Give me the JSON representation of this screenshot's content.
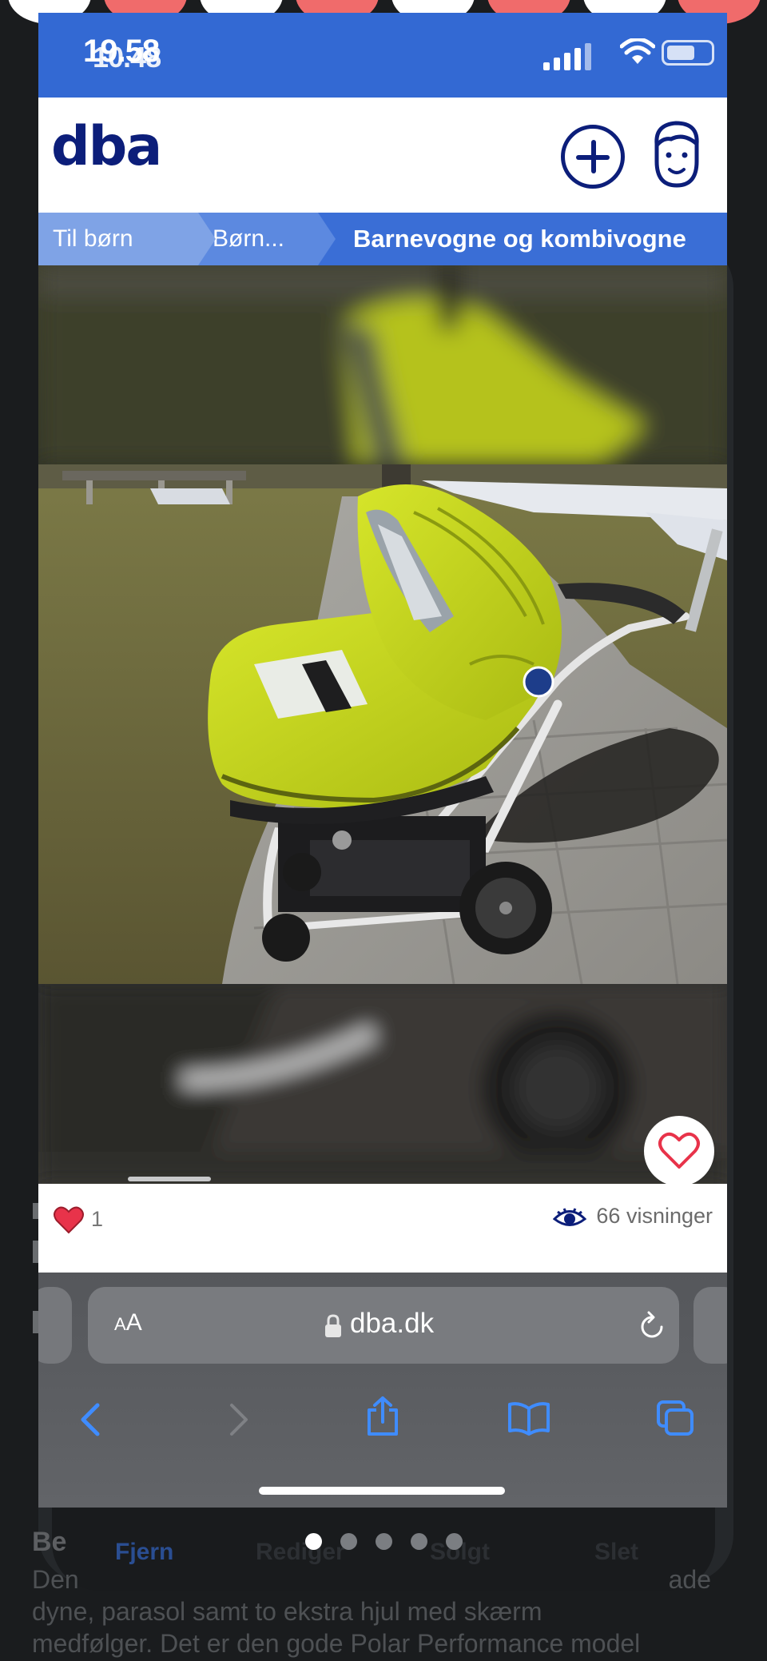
{
  "status": {
    "time_primary": "19.58",
    "time_secondary": "10.48"
  },
  "header": {
    "logo": "dba"
  },
  "breadcrumb": {
    "items": [
      "Til børn",
      "Børn...",
      "Barnevogne og kombivogne"
    ]
  },
  "listing": {
    "likes": "1",
    "views": "66 visninger"
  },
  "browser": {
    "aa_small": "A",
    "aa_large": "A",
    "url": "dba.dk"
  },
  "background": {
    "menu": [
      "Fjern",
      "Rediger",
      "Solgt",
      "Slet"
    ],
    "heading": "Be",
    "description_lines": [
      "Den",
      "ade",
      "dyne, parasol samt to ekstra hjul med skærm",
      "medfølger. Det er den gode Polar Performance model"
    ]
  },
  "colors": {
    "dba_blue": "#0c1e7a",
    "status_blue": "#3369d3",
    "stroller_green": "#c9dc1f",
    "heart_red": "#e8334a"
  }
}
